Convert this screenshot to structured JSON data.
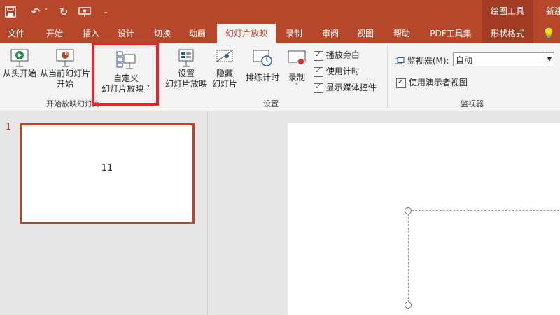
{
  "quick_access": {
    "save": "save-icon",
    "undo": "undo-icon",
    "redo": "redo-icon",
    "present": "present-icon",
    "customize": "customize-icon"
  },
  "context_tab": "绘图工具",
  "new_file": "新建",
  "tabs": [
    "文件",
    "开始",
    "插入",
    "设计",
    "切换",
    "动画",
    "幻灯片放映",
    "录制",
    "审阅",
    "视图",
    "帮助",
    "PDF工具集",
    "形状格式"
  ],
  "active_tab": "幻灯片放映",
  "ribbon": {
    "start_group": {
      "label": "开始放映幻灯片",
      "from_beginning": "从头开始",
      "from_current_1": "从当前幻灯片",
      "from_current_2": "开始",
      "custom_1": "自定义",
      "custom_2": "幻灯片放映 ˅"
    },
    "setup_group": {
      "label": "设置",
      "setup_1": "设置",
      "setup_2": "幻灯片放映",
      "hide_1": "隐藏",
      "hide_2": "幻灯片",
      "rehearse": "排练计时",
      "record": "录制",
      "record_arrow": "˅",
      "play_narration": "播放旁白",
      "use_timings": "使用计时",
      "show_media": "显示媒体控件"
    },
    "monitor_group": {
      "label": "监视器",
      "monitor_label": "监视器(M):",
      "monitor_value": "自动",
      "presenter_view": "使用演示者视图"
    }
  },
  "thumbnail": {
    "number": "1",
    "text": "11"
  },
  "colors": {
    "accent": "#b7472a",
    "highlight": "#e8232a"
  }
}
